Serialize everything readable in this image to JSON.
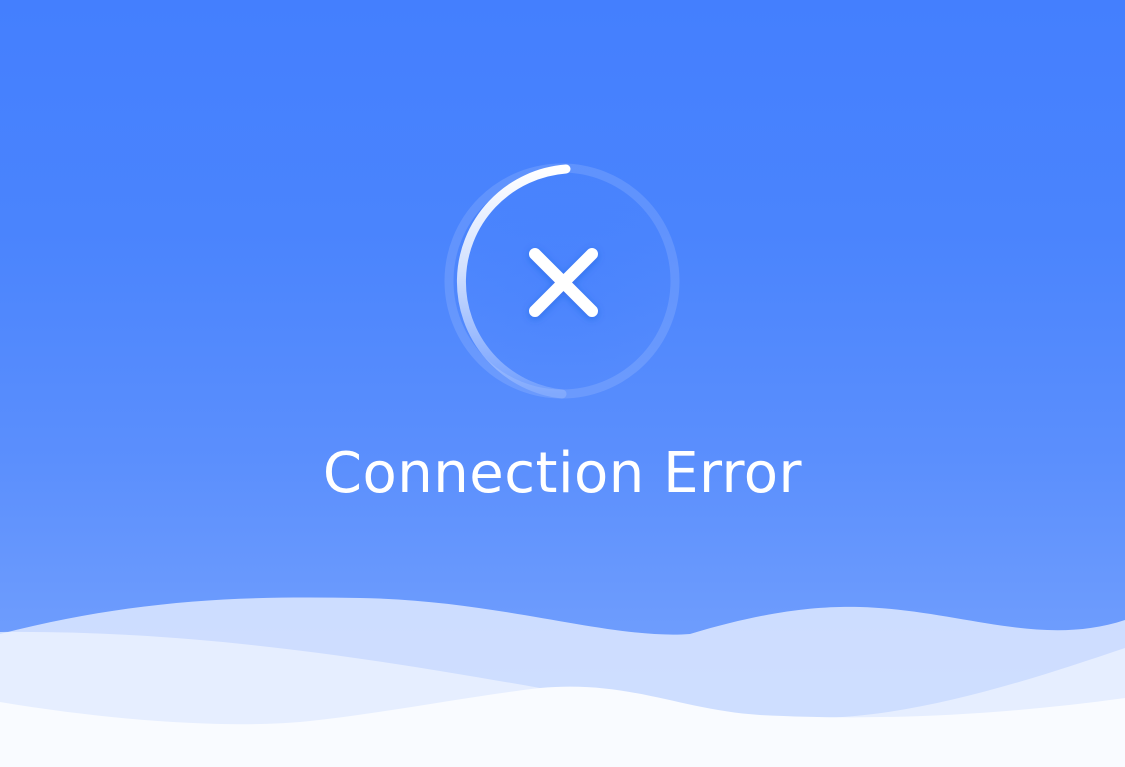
{
  "error": {
    "title": "Connection Error",
    "icon": "close-icon",
    "ring": "loading-ring"
  },
  "colors": {
    "background_top": "#447ffe",
    "background_bottom": "#79a4fd",
    "foreground": "#ffffff",
    "wave_light": "#d6e3ff",
    "wave_white": "#f9fbff"
  }
}
